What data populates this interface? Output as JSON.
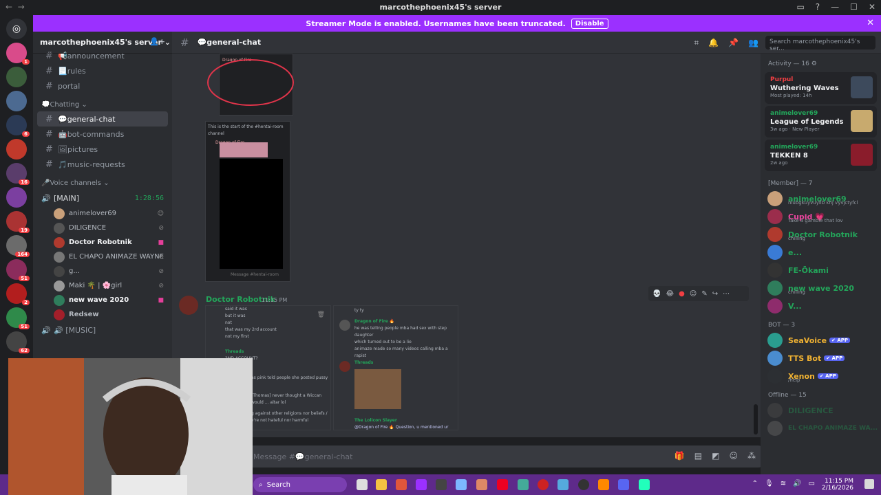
{
  "window": {
    "title": "marcothephoenix45's server"
  },
  "banner": {
    "text": "Streamer Mode is enabled. Usernames have been truncated.",
    "button": "Disable"
  },
  "server": {
    "name": "marcothephoenix45's server"
  },
  "channels": {
    "top": [
      {
        "label": "📢announcement"
      },
      {
        "label": "📃rules"
      },
      {
        "label": "portal"
      }
    ],
    "category_chatting": "💭Chatting",
    "chatting": [
      {
        "label": "💬general-chat",
        "active": true
      },
      {
        "label": "🤖bot-commands"
      },
      {
        "label": "🖼pictures"
      },
      {
        "label": "🎵music-requests"
      }
    ],
    "category_voice": "🎤Voice channels",
    "voice_main": {
      "label": "[MAIN]",
      "timer": "1:28:56"
    },
    "voice_users": [
      {
        "name": "animelover69",
        "color": "#c9a07a"
      },
      {
        "name": "DILIGENCE",
        "color": "#555"
      },
      {
        "name": "Doctor Robotnik",
        "color": "#b03a2e",
        "bold": true
      },
      {
        "name": "EL CHAPO ANIMAZE WAYNE",
        "color": "#777"
      },
      {
        "name": "g...",
        "color": "#444"
      },
      {
        "name": "Maki 🌴 | 🌸girl",
        "color": "#999"
      },
      {
        "name": "new wave 2020",
        "color": "#2f7d5c",
        "bold": true
      },
      {
        "name": "Redsew",
        "color": "#a31f2a"
      }
    ],
    "voice_music": {
      "label": "🔊 [MUSIC]"
    }
  },
  "chat": {
    "channel_name": "💬general-chat",
    "search_placeholder": "Search marcothephoenix45's ser...",
    "message": {
      "author": "Doctor Robotnik",
      "time": "11:15 PM"
    },
    "shot_left_lines": [
      "said it was",
      "but it was",
      "not",
      "that was my 2rd account",
      "not my first"
    ],
    "shot_left_threads": "Threads",
    "shot_left_quote": "2ND ACCOUNT?",
    "shot_left_more": "as pink told people she posted pussy",
    "shot_left_tail": "[Thomas] never thought a Wiccan would ... altar lol",
    "shot_left_tail2": "g against other religions nor beliefs / y're not hateful nor harmful",
    "shot_right_top": "ty ty",
    "shot_right_author": "Dragon of Fire 🔥",
    "shot_right_lines": [
      "he was telling people mba had sex with step daughter",
      "which turned out to be a lie",
      "animaze made so many videos calling mba a rapist"
    ],
    "shot_right_threads": "Threads",
    "shot_right_slayer": "The Lolicon Slayer",
    "shot_right_reply": "@Dragon of Fire 🔥 Question, u mentioned ur",
    "shot_top_header": "This is the start of the #hentai-room channel",
    "shot_top_author": "Dragon of Fire",
    "shot_top_input": "Message #hentai-room",
    "composer_placeholder": "Message #💬general-chat"
  },
  "members": {
    "activity_header": "Activity — 16",
    "activity": [
      {
        "user": "Purpul",
        "user_color": "#f23f43",
        "game": "Wuthering Waves",
        "sub": "Most played: 14h",
        "thumb": "#3d4a5c"
      },
      {
        "user": "animelover69",
        "user_color": "#23a55a",
        "game": "League of Legends",
        "sub": "3w ago · New Player",
        "thumb": "#c8aa6e"
      },
      {
        "user": "animelover69",
        "user_color": "#23a55a",
        "game": "TEKKEN 8",
        "sub": "2w ago",
        "thumb": "#8a1c2b"
      }
    ],
    "member_header": "[Member] — 7",
    "member_list": [
      {
        "name": "animelover69",
        "color": "#23a55a",
        "status": "nlubgkuyvuyllb khj vyvjctyfcl",
        "av": "#c9a07a"
      },
      {
        "name": "Cupid 💗",
        "color": "#eb459e",
        "status": "Take a gamble that lov",
        "av": "#9b2d4c"
      },
      {
        "name": "Doctor Robotnik",
        "color": "#23a55a",
        "status": "chilling",
        "av": "#b03a2e"
      },
      {
        "name": "e...",
        "color": "#23a55a",
        "status": "",
        "av": "#3a7bd5"
      },
      {
        "name": "FE-Ōkami",
        "color": "#23a55a",
        "status": "",
        "av": "#333"
      },
      {
        "name": "new wave 2020",
        "color": "#23a55a",
        "status": "chilling",
        "av": "#2f7d5c"
      },
      {
        "name": "V...",
        "color": "#23a55a",
        "status": "",
        "av": "#8e2c6c"
      }
    ],
    "bot_header": "BOT — 3",
    "bots": [
      {
        "name": "SeaVoice",
        "tag": "✔ APP",
        "status": "",
        "av": "#2a9d8f"
      },
      {
        "name": "TTS Bot",
        "tag": "✔ APP",
        "status": "",
        "av": "#4a8ccf"
      },
      {
        "name": "Xenon",
        "tag": "✔ APP",
        "status": "/help",
        "av": "#2c2f33"
      }
    ],
    "offline_header": "Offline — 15",
    "offline": [
      {
        "name": "DILIGENCE",
        "av": "#555"
      },
      {
        "name": "EL CHAPO ANIMAZE WA...",
        "av": "#777"
      }
    ]
  },
  "taskbar": {
    "search": "Search",
    "time": "11:15 PM",
    "date": "2/16/2026"
  },
  "guild_badges": [
    "1",
    "6",
    "16",
    "19",
    "164",
    "51",
    "2",
    "51",
    "62"
  ]
}
